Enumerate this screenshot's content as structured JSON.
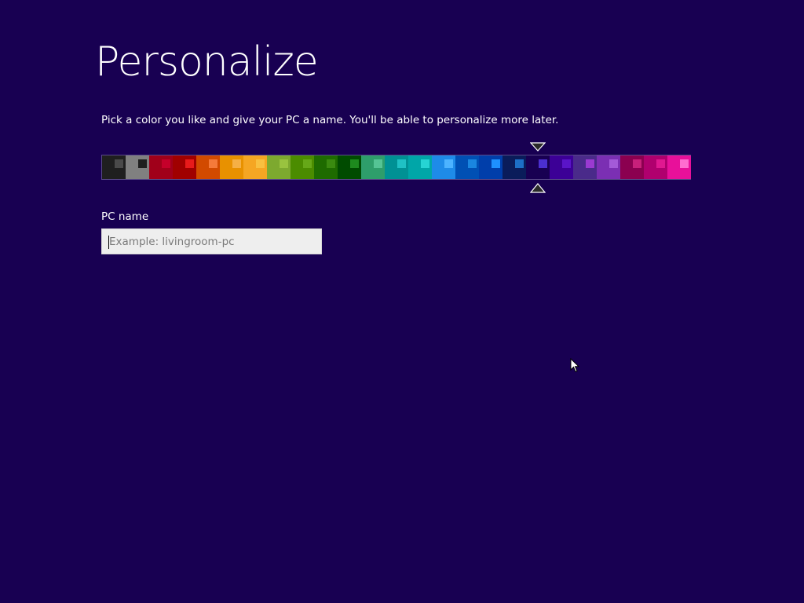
{
  "page": {
    "title": "Personalize",
    "instruction": "Pick a color you like and give your PC a name. You'll be able to personalize more later.",
    "background_color": "#180052"
  },
  "color_picker": {
    "selected_index": 18,
    "swatches": [
      {
        "bg": "#1f1f1f",
        "accent": "#4a4a4a"
      },
      {
        "bg": "#808080",
        "accent": "#1f1f1f"
      },
      {
        "bg": "#a0001a",
        "accent": "#c5002a"
      },
      {
        "bg": "#a00000",
        "accent": "#e81b1b"
      },
      {
        "bg": "#d24a00",
        "accent": "#f57a3a"
      },
      {
        "bg": "#e89100",
        "accent": "#f5b045"
      },
      {
        "bg": "#f5a623",
        "accent": "#f8c040"
      },
      {
        "bg": "#7da92f",
        "accent": "#99c33f"
      },
      {
        "bg": "#4b8c00",
        "accent": "#66a818"
      },
      {
        "bg": "#1e6b00",
        "accent": "#3a8a10"
      },
      {
        "bg": "#004b00",
        "accent": "#1e8a1e"
      },
      {
        "bg": "#2e9e6b",
        "accent": "#55c495"
      },
      {
        "bg": "#009194",
        "accent": "#1fc1c4"
      },
      {
        "bg": "#00a6a8",
        "accent": "#26d4d4"
      },
      {
        "bg": "#1e8be8",
        "accent": "#4cb3ff"
      },
      {
        "bg": "#0050b4",
        "accent": "#1a86e0"
      },
      {
        "bg": "#003eaa",
        "accent": "#1e90ff"
      },
      {
        "bg": "#0a1c5a",
        "accent": "#1d6fc6"
      },
      {
        "bg": "#180052",
        "accent": "#4b2fcf"
      },
      {
        "bg": "#3c0096",
        "accent": "#5a14c8"
      },
      {
        "bg": "#4a2a8a",
        "accent": "#9a3ad1"
      },
      {
        "bg": "#7b2fb3",
        "accent": "#a35ad8"
      },
      {
        "bg": "#8b0050",
        "accent": "#c8207a"
      },
      {
        "bg": "#b0006e",
        "accent": "#e01890"
      },
      {
        "bg": "#e8109a",
        "accent": "#ff6ed0"
      }
    ]
  },
  "pc_name": {
    "label": "PC name",
    "placeholder": "Example: livingroom-pc",
    "value": ""
  },
  "icons": {
    "selector_top": "down-triangle-icon",
    "selector_bottom": "up-triangle-icon",
    "mouse": "mouse-pointer-icon"
  }
}
